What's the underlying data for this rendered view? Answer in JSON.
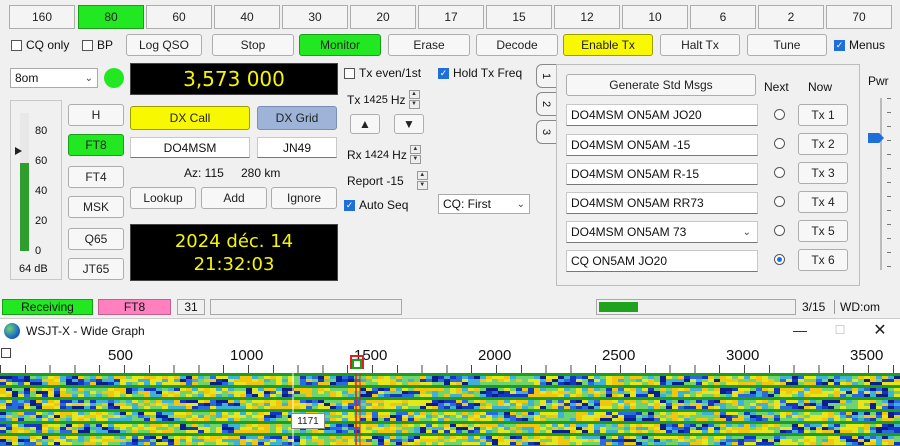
{
  "bands": [
    "160",
    "80",
    "60",
    "40",
    "30",
    "20",
    "17",
    "15",
    "12",
    "10",
    "6",
    "2",
    "70"
  ],
  "selected_band": "80",
  "controls": {
    "cq_only": "CQ only",
    "bp": "BP",
    "log_qso": "Log QSO",
    "stop": "Stop",
    "monitor": "Monitor",
    "erase": "Erase",
    "decode": "Decode",
    "enable_tx": "Enable Tx",
    "halt_tx": "Halt Tx",
    "tune": "Tune",
    "menus": "Menus"
  },
  "band_select": "8om",
  "frequency": "3,573 000",
  "modes": [
    "H",
    "FT8",
    "FT4",
    "MSK",
    "Q65",
    "JT65"
  ],
  "selected_mode": "FT8",
  "meter": {
    "ticks": [
      "80",
      "60",
      "40",
      "20",
      "0"
    ],
    "readout": "64 dB",
    "level_percent": 64
  },
  "dx": {
    "call_button": "DX Call",
    "grid_button": "DX Grid",
    "call_value": "DO4MSM",
    "grid_value": "JN49",
    "az": "Az: 115",
    "distance": "280 km",
    "lookup": "Lookup",
    "add": "Add",
    "ignore": "Ignore"
  },
  "clock": {
    "date": "2024 déc. 14",
    "time": "21:32:03"
  },
  "tx_options": {
    "tx_even": "Tx even/1st",
    "hold_tx": "Hold Tx Freq",
    "tx_label": "Tx",
    "tx_freq": "1425",
    "hz": "Hz",
    "rx_label": "Rx",
    "rx_freq": "1424",
    "report": "Report -15",
    "auto_seq": "Auto Seq",
    "cq_select": "CQ: First"
  },
  "tabs": [
    "1",
    "2",
    "3"
  ],
  "msgs": {
    "generate": "Generate Std Msgs",
    "next": "Next",
    "now": "Now",
    "items": [
      {
        "text": "DO4MSM ON5AM JO20",
        "tx": "Tx 1"
      },
      {
        "text": "DO4MSM ON5AM -15",
        "tx": "Tx 2"
      },
      {
        "text": "DO4MSM ON5AM R-15",
        "tx": "Tx 3"
      },
      {
        "text": "DO4MSM ON5AM RR73",
        "tx": "Tx 4"
      },
      {
        "text": "DO4MSM ON5AM 73",
        "tx": "Tx 5"
      },
      {
        "text": "CQ ON5AM JO20",
        "tx": "Tx 6"
      }
    ],
    "selected_next": 5
  },
  "pwr": {
    "label": "Pwr"
  },
  "status_bar": {
    "receiving": "Receiving",
    "mode": "FT8",
    "count": "31",
    "progress": "3/15",
    "progress_fraction": 0.2,
    "wd": "WD:om"
  },
  "wide_graph": {
    "title": "WSJT-X - Wide Graph",
    "ticks": [
      "500",
      "1000",
      "1500",
      "2000",
      "2500",
      "3000",
      "3500"
    ],
    "marker_readout": "1171"
  },
  "colors": {
    "green": "#22e822",
    "yellow": "#f8f800",
    "pink": "#ff7fbf",
    "blue": "#9db3d8",
    "lcd_text": "#f6f600",
    "waterfall_bg": "#0a1e8c"
  }
}
